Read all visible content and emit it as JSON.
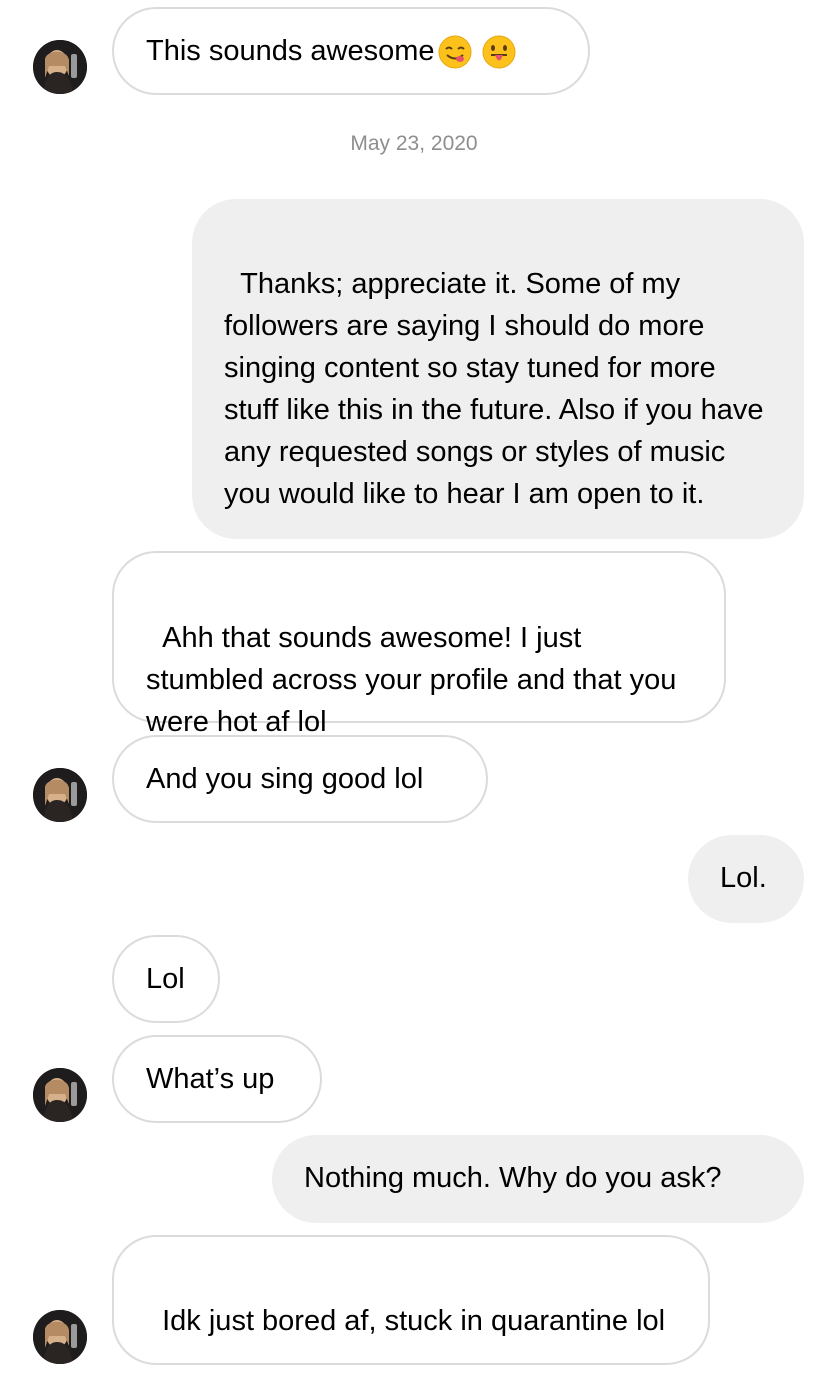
{
  "messages": [
    {
      "from": "them",
      "text": "This sounds awesome",
      "emojis": [
        "yum-face-icon",
        "tongue-face-icon"
      ]
    },
    {
      "timestamp": "May 23, 2020"
    },
    {
      "from": "me",
      "text": "Thanks; appreciate it. Some of my followers are saying I should do more singing content so stay tuned for more stuff like this in the future. Also if you have any requested songs or styles of music you would like to hear I am open to it."
    },
    {
      "from": "them",
      "text": "Ahh that sounds awesome! I just stumbled across your profile and that you were hot af lol"
    },
    {
      "from": "them",
      "text": "And you sing good lol"
    },
    {
      "from": "me",
      "text": "Lol."
    },
    {
      "from": "them",
      "text": "Lol"
    },
    {
      "from": "them",
      "text": "What’s up"
    },
    {
      "from": "me",
      "text": "Nothing much. Why do you ask?"
    },
    {
      "from": "them",
      "text": "Idk just bored af, stuck in quarantine lol"
    }
  ],
  "colors": {
    "incoming_border": "#dbdbdb",
    "outgoing_fill": "#efefef",
    "timestamp": "#8e8e8e"
  }
}
